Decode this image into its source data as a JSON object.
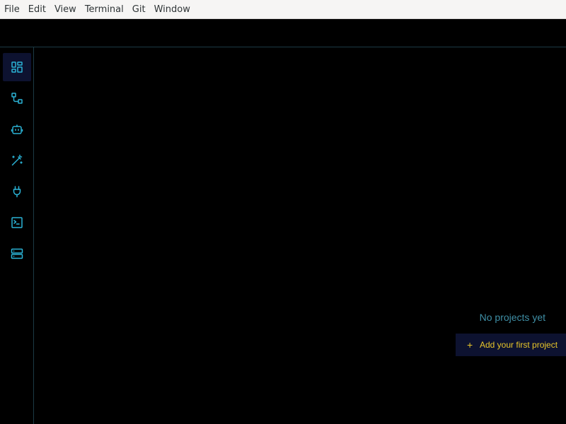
{
  "menubar": {
    "items": [
      "File",
      "Edit",
      "View",
      "Terminal",
      "Git",
      "Window"
    ]
  },
  "sidebar": {
    "items": [
      {
        "icon": "dashboard-icon",
        "active": true
      },
      {
        "icon": "workflow-icon",
        "active": false
      },
      {
        "icon": "robot-icon",
        "active": false
      },
      {
        "icon": "magic-wand-icon",
        "active": false
      },
      {
        "icon": "plug-icon",
        "active": false
      },
      {
        "icon": "terminal-icon",
        "active": false
      },
      {
        "icon": "server-icon",
        "active": false
      }
    ]
  },
  "main": {
    "empty_message": "No projects yet",
    "add_button": {
      "icon": "+",
      "label": "Add your first project"
    }
  },
  "colors": {
    "accent": "#2bb3d6",
    "button_text": "#e8c62a",
    "active_bg": "#0d1230",
    "muted_text": "#3f8fa6",
    "background": "#000000"
  }
}
